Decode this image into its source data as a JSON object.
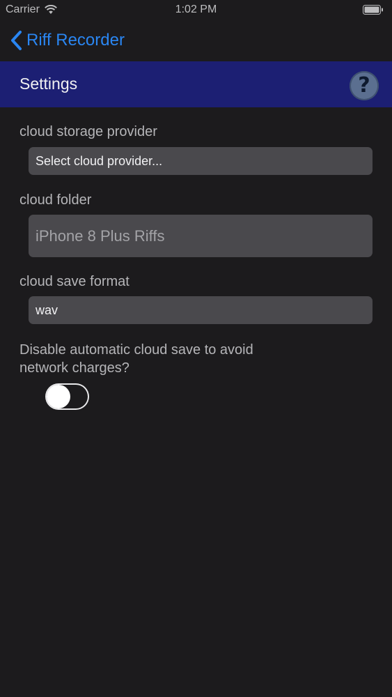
{
  "status_bar": {
    "carrier": "Carrier",
    "time": "1:02 PM"
  },
  "nav": {
    "back_label": "Riff Recorder"
  },
  "header": {
    "title": "Settings",
    "help_glyph": "?"
  },
  "settings": {
    "cloud_provider_label": "cloud storage provider",
    "cloud_provider_value": "Select cloud provider...",
    "cloud_folder_label": "cloud folder",
    "cloud_folder_placeholder": "iPhone 8 Plus Riffs",
    "cloud_format_label": "cloud save format",
    "cloud_format_value": "wav",
    "auto_save_label_line1": "Disable automatic cloud save  to avoid",
    "auto_save_label_line2": "network charges?",
    "auto_save_disabled": false
  },
  "colors": {
    "background": "#1c1b1d",
    "accent_blue": "#2a86f2",
    "header_band": "#1c1f73",
    "field_bg": "#4a494d"
  },
  "icons": {
    "back": "chevron-left-icon",
    "help": "question-mark-icon",
    "wifi": "wifi-icon",
    "battery": "battery-icon"
  }
}
